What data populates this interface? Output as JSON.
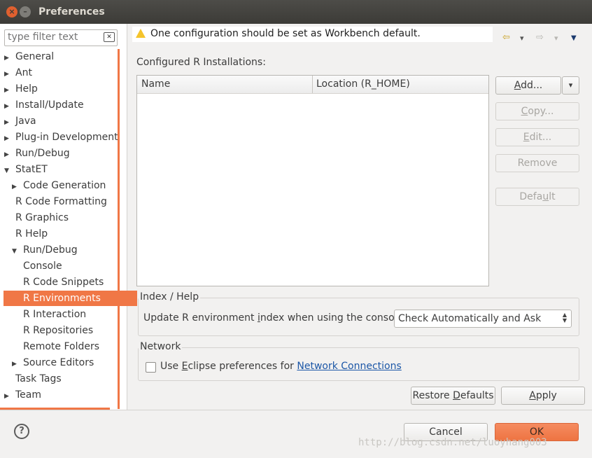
{
  "window": {
    "title": "Preferences",
    "close": "×",
    "minimize": "–"
  },
  "filter": {
    "placeholder": "type filter text"
  },
  "tree": [
    {
      "label": "General",
      "arrow": "▶"
    },
    {
      "label": "Ant",
      "arrow": "▶"
    },
    {
      "label": "Help",
      "arrow": "▶"
    },
    {
      "label": "Install/Update",
      "arrow": "▶"
    },
    {
      "label": "Java",
      "arrow": "▶"
    },
    {
      "label": "Plug-in Development",
      "arrow": "▶"
    },
    {
      "label": "Run/Debug",
      "arrow": "▶"
    },
    {
      "label": "StatET",
      "arrow": "▼"
    },
    {
      "label": "Code Generation",
      "arrow": "▶"
    },
    {
      "label": "R Code Formatting",
      "arrow": ""
    },
    {
      "label": "R Graphics",
      "arrow": ""
    },
    {
      "label": "R Help",
      "arrow": ""
    },
    {
      "label": "Run/Debug",
      "arrow": "▼"
    },
    {
      "label": "Console",
      "arrow": ""
    },
    {
      "label": "R Code Snippets",
      "arrow": ""
    },
    {
      "label": "R Environments",
      "arrow": ""
    },
    {
      "label": "R Interaction",
      "arrow": ""
    },
    {
      "label": "R Repositories",
      "arrow": ""
    },
    {
      "label": "Remote Folders",
      "arrow": ""
    },
    {
      "label": "Source Editors",
      "arrow": "▶"
    },
    {
      "label": "Task Tags",
      "arrow": ""
    },
    {
      "label": "Team",
      "arrow": "▶"
    }
  ],
  "selected_index": 15,
  "warning": {
    "text": "One configuration should be set as Workbench default."
  },
  "nav": {
    "back": "⇦",
    "forward": "⇨",
    "dropdown": "▾",
    "menu": "▼"
  },
  "installations": {
    "label": "Configured R Installations:",
    "columns": [
      "Name",
      "Location (R_HOME)"
    ],
    "rows": []
  },
  "buttons": {
    "add": {
      "pre": "",
      "mnemonic": "A",
      "post": "dd..."
    },
    "add_dropdown": "▾",
    "copy": {
      "pre": "",
      "mnemonic": "C",
      "post": "opy..."
    },
    "edit": {
      "pre": "",
      "mnemonic": "E",
      "post": "dit..."
    },
    "remove": "Remove",
    "default": {
      "pre": "Defa",
      "mnemonic": "u",
      "post": "lt"
    },
    "restore_defaults": {
      "pre": "Restore ",
      "mnemonic": "D",
      "post": "efaults"
    },
    "apply": {
      "pre": "",
      "mnemonic": "A",
      "post": "pply"
    },
    "cancel": "Cancel",
    "ok": "OK"
  },
  "index_help": {
    "title": "Index / Help",
    "label_pre": "Update R environment ",
    "label_mnemonic": "i",
    "label_post": "ndex when using the console:",
    "select_value": "Check Automatically and Ask",
    "updown": "▲▼"
  },
  "network": {
    "title": "Network",
    "checkbox_pre": "Use ",
    "checkbox_mnemonic": "E",
    "checkbox_post": "clipse preferences for ",
    "link": "Network Connections"
  },
  "help": {
    "glyph": "?"
  },
  "watermark": "http://blog.csdn.net/luoyhang003"
}
